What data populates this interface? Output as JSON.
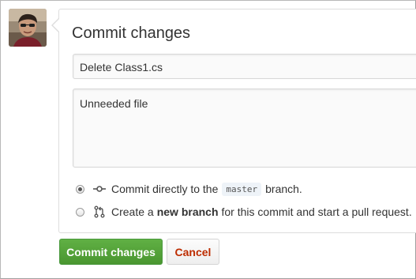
{
  "form": {
    "title": "Commit changes",
    "summary_value": "Delete Class1.cs",
    "description_value": "Unneeded file"
  },
  "options": {
    "direct": {
      "selected": true,
      "icon": "git-commit-icon",
      "text_before": "Commit directly to the",
      "branch": "master",
      "text_after": "branch."
    },
    "new_branch": {
      "selected": false,
      "icon": "git-pull-request-icon",
      "text_before": "Create a",
      "strong": "new branch",
      "text_after": "for this commit and start a pull request."
    }
  },
  "buttons": {
    "commit_label": "Commit changes",
    "cancel_label": "Cancel"
  },
  "colors": {
    "commit_button": "#55a532",
    "cancel_text": "#bd2c00"
  }
}
